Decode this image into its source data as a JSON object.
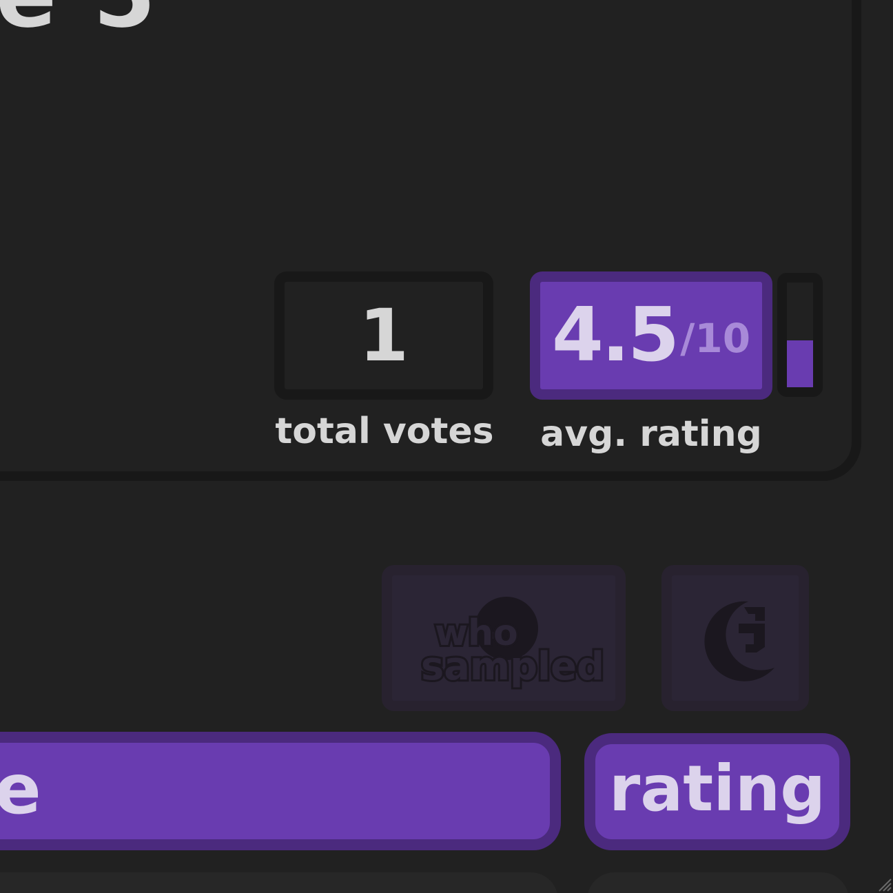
{
  "song": {
    "title_fragment": "e 5"
  },
  "stats": {
    "total_votes": "1",
    "total_votes_label": "total votes",
    "avg_rating": "4.5",
    "avg_rating_suffix": "/10",
    "avg_rating_label": "avg. rating",
    "rating_meter_fraction": 0.45
  },
  "links": {
    "whosampled_line1": "who",
    "whosampled_line2": "sampled",
    "genius_icon": "genius-g-icon"
  },
  "actions": {
    "left_button_fragment": "e",
    "rating_button": "rating"
  },
  "colors": {
    "background": "#212121",
    "accent": "#693cb0",
    "accent_border": "#4b2a7e",
    "text": "#d6d6d6"
  }
}
